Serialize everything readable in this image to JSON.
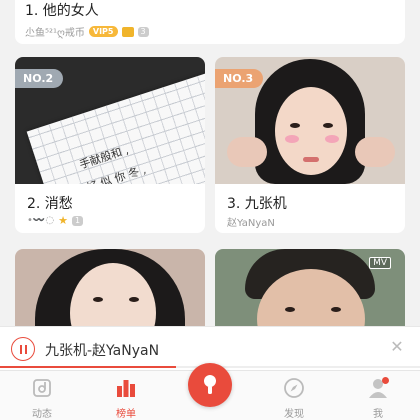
{
  "top_item": {
    "title": "1. 他的女人",
    "artist": "尐鱼⁵²¹ღ戒币",
    "vip": "VIP5",
    "badge_count": "3"
  },
  "cards": [
    {
      "rank_tag": "NO.2",
      "title": "2. 消愁",
      "artist": "•〰️◌",
      "badge_count": "1",
      "paper_lines": [
        "手献般和 ,",
        "好 似 你 冬 ,"
      ]
    },
    {
      "rank_tag": "NO.3",
      "title": "3. 九张机",
      "artist": "赵YaNyaN"
    },
    {
      "mv": "MV"
    }
  ],
  "player": {
    "now_playing": "九张机-赵YaNyaN",
    "progress": 0.42
  },
  "tabs": [
    {
      "label": "动态",
      "icon": "feed-icon"
    },
    {
      "label": "榜单",
      "icon": "chart-icon",
      "active": true
    },
    {
      "label": "",
      "icon": "mic-icon"
    },
    {
      "label": "发现",
      "icon": "compass-icon"
    },
    {
      "label": "我",
      "icon": "profile-icon"
    }
  ],
  "colors": {
    "accent": "#e94b3c",
    "rank2": "#aab4be",
    "rank3": "#eca06e"
  }
}
